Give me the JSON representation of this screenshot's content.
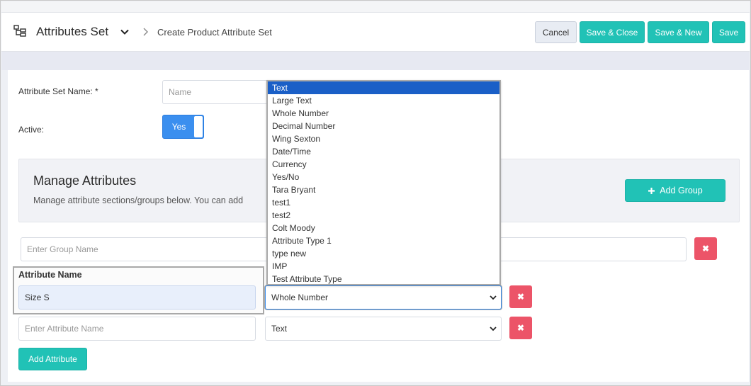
{
  "header": {
    "title": "Attributes Set",
    "breadcrumb": "Create Product Attribute Set",
    "cancel_label": "Cancel",
    "save_close_label": "Save & Close",
    "save_new_label": "Save & New",
    "save_label": "Save"
  },
  "form": {
    "name_label": "Attribute Set Name: *",
    "name_placeholder": "Name",
    "active_label": "Active:",
    "active_value": "Yes"
  },
  "manage": {
    "title": "Manage Attributes",
    "description": "Manage attribute sections/groups below. You can add",
    "add_group_label": "Add Group"
  },
  "group": {
    "placeholder": "Enter Group Name",
    "remove_label": "✖"
  },
  "attributes": {
    "header": "Attribute Name",
    "rows": [
      {
        "name": "Size S",
        "type": "Whole Number",
        "remove_label": "✖"
      },
      {
        "placeholder": "Enter Attribute Name",
        "type": "Text",
        "remove_label": "✖"
      }
    ],
    "add_label": "Add Attribute"
  },
  "dropdown": {
    "selected": "Text",
    "options": [
      "Text",
      "Large Text",
      "Whole Number",
      "Decimal Number",
      "Wing Sexton",
      "Date/Time",
      "Currency",
      "Yes/No",
      "Tara Bryant",
      "test1",
      "test2",
      "Colt Moody",
      "Attribute Type 1",
      "type new",
      "IMP",
      "Test Attribute Type"
    ]
  },
  "colors": {
    "accent_teal": "#21c2b6",
    "toggle_blue": "#3b8fef",
    "danger_red": "#ec5468",
    "selected_option": "#1a5fc7"
  },
  "icons": {
    "header_icon": "hierarchy-icon",
    "caret": "chevron-down-icon",
    "separator": "chevron-right-icon",
    "add_group": "plus-icon",
    "remove": "close-icon"
  }
}
